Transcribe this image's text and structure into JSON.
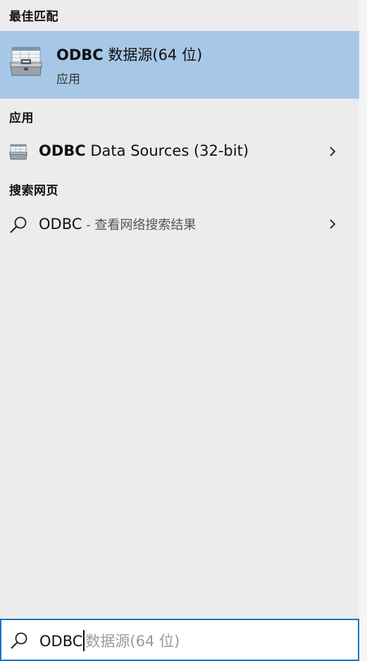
{
  "sections": {
    "best_match": "最佳匹配",
    "apps": "应用",
    "web": "搜索网页"
  },
  "best_match_item": {
    "title_bold": "ODBC",
    "title_rest": " 数据源(64 位)",
    "subtitle": "应用",
    "icon": "odbc-toolbox-icon",
    "highlight_color": "#a6c8e6"
  },
  "app_results": [
    {
      "bold": "ODBC",
      "rest": " Data Sources (32-bit)",
      "icon": "odbc-toolbox-icon"
    }
  ],
  "web_results": [
    {
      "text": "ODBC",
      "suffix": " - 查看网络搜索结果",
      "icon": "search-icon"
    }
  ],
  "search": {
    "typed": "ODBC",
    "suggestion": "数据源(64 位)",
    "border_color": "#1a73c8",
    "icon": "search-icon"
  }
}
